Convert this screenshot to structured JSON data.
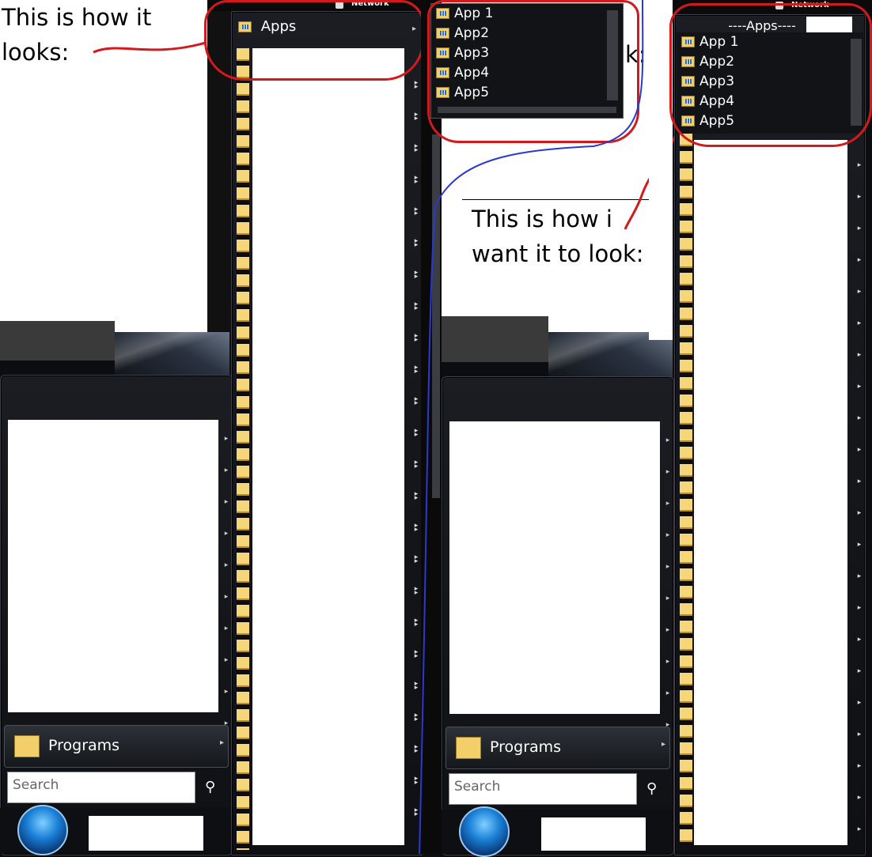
{
  "left": {
    "caption": "This is how it\nlooks:",
    "submenu_header": "Apps",
    "start_menu": {
      "programs_label": "Programs",
      "search_placeholder": "Search",
      "search_icon": "search-icon"
    },
    "top_bar": {
      "network": "Network"
    }
  },
  "middle": {
    "popup_items": [
      "App 1",
      "App2",
      "App3",
      "App4",
      "App5"
    ],
    "caption": "This is how i\nwant it to look:",
    "stray_text": "k:",
    "start_menu": {
      "programs_label": "Programs",
      "search_placeholder": "Search"
    }
  },
  "right": {
    "header": "----Apps----",
    "top_bar": {
      "network": "Network"
    },
    "items": [
      "App 1",
      "App2",
      "App3",
      "App4",
      "App5"
    ]
  },
  "annotation_colors": {
    "red": "#d3191c",
    "blue": "#2a3ad0"
  }
}
